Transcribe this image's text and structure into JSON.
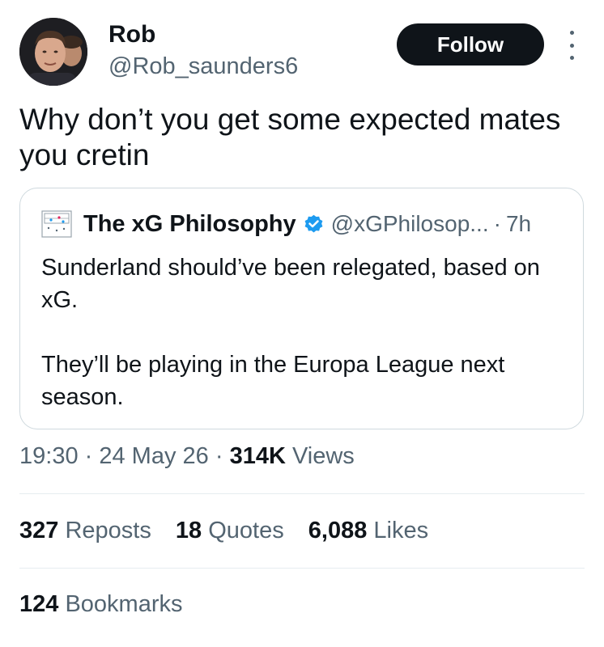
{
  "author": {
    "name": "Rob",
    "handle": "@Rob_saunders6",
    "follow_label": "Follow"
  },
  "tweet": {
    "text": "Why don’t you get some expected mates you cretin"
  },
  "quoted_tweet": {
    "name": "The xG Philosophy",
    "handle": "@xGPhilosop...",
    "separator": "·",
    "time": "7h",
    "paragraph_1": "Sunderland should’ve been relegated, based on xG.",
    "paragraph_2": "They’ll be playing in the Europa League next season."
  },
  "meta": {
    "time": "19:30",
    "sep1": " · ",
    "date": "24 May 26",
    "sep2": " · ",
    "views_count": "314K",
    "views_label": " Views"
  },
  "stats": {
    "reposts_count": "327",
    "reposts_label": " Reposts",
    "quotes_count": "18",
    "quotes_label": " Quotes",
    "likes_count": "6,088",
    "likes_label": " Likes",
    "bookmarks_count": "124",
    "bookmarks_label": " Bookmarks"
  },
  "colors": {
    "primary_text": "#0f1419",
    "secondary_text": "#536471",
    "follow_bg": "#0f1419",
    "verified_blue": "#1d9bf0",
    "border": "#cfd9de"
  },
  "icons": {
    "verified": "verified-badge-icon",
    "more": "more-vertical-icon"
  }
}
